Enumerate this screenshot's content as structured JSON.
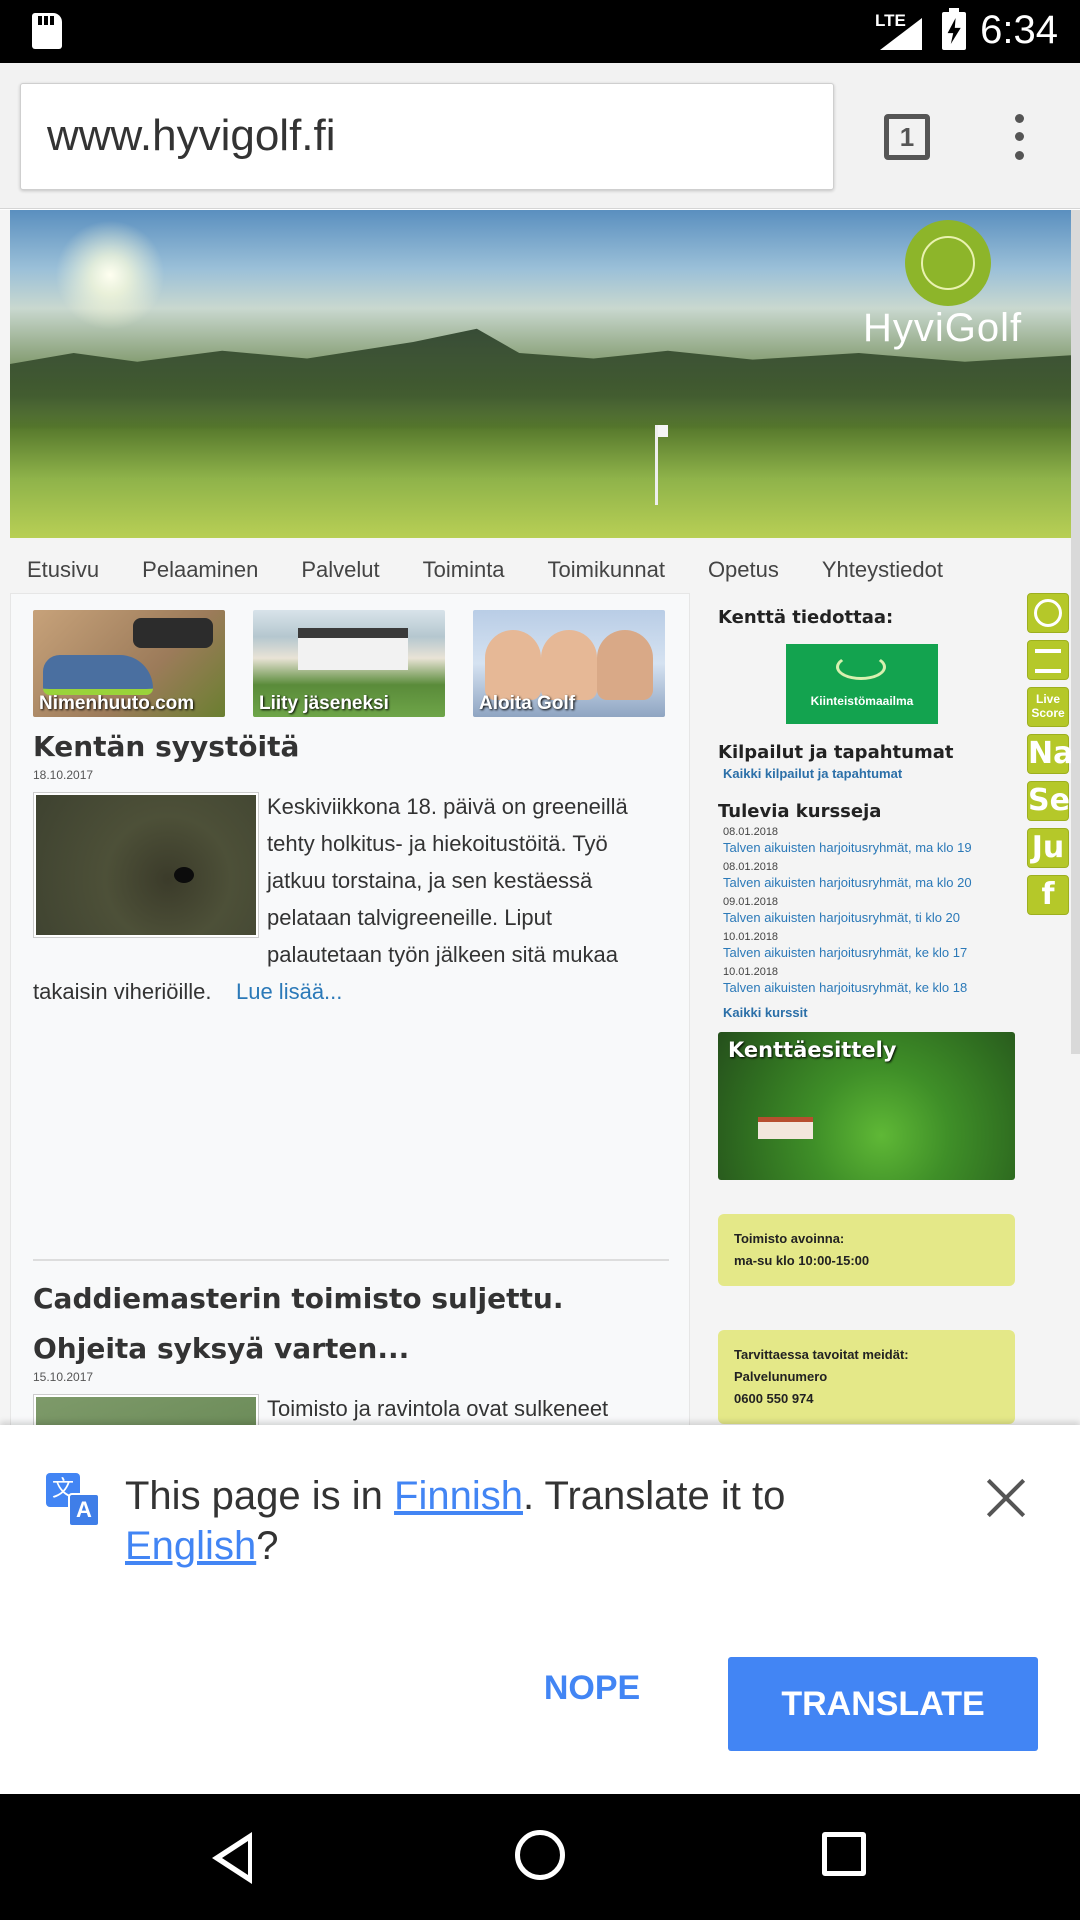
{
  "status_bar": {
    "network": "LTE",
    "time": "6:34"
  },
  "browser": {
    "url": "www.hyvigolf.fi",
    "tab_count": "1"
  },
  "site": {
    "logo_text": "HyviGolf",
    "nav": [
      "Etusivu",
      "Pelaaminen",
      "Palvelut",
      "Toiminta",
      "Toimikunnat",
      "Opetus",
      "Yhteystiedot"
    ],
    "promos": [
      "Nimenhuuto.com",
      "Liity jäseneksi",
      "Aloita Golf"
    ],
    "articles": [
      {
        "title": "Kentän syystöitä",
        "date": "18.10.2017",
        "body": "Keskiviikkona 18. päivä on greeneillä tehty holkitus- ja hiekoitustöitä. Työ jatkuu torstaina, ja sen kestäessä pelataan talvigreeneille. Liput palautetaan työn jälkeen sitä mukaa takaisin viheriöille.",
        "read_more": "Lue lisää..."
      },
      {
        "title": "Caddiemasterin toimisto suljettu. Ohjeita syksyä varten...",
        "date": "15.10.2017",
        "body": "Toimisto ja ravintola ovat sulkeneet ovensa tämän kauden osalta. Myös taukokioskin wc:t on suljettu. Talvikaudella tavoitatte meidät seuraavasti: Hyvigolf Oy:n asiat: mika.nieminen@hyvigolf.fi tai 040 5290706 Hyvinkään Golf ry:n seura-asiat: petteri.oksanen@hyvigolf.fi tai 0400 612174"
      }
    ],
    "sidebar": {
      "notice_heading": "Kenttä tiedottaa:",
      "notice_logo": "Kiinteistömaailma",
      "events_heading": "Kilpailut ja tapahtumat",
      "events_link": "Kaikki kilpailut ja tapahtumat",
      "courses_heading": "Tulevia kursseja",
      "courses": [
        {
          "date": "08.01.2018",
          "name": "Talven aikuisten harjoitusryhmät, ma klo 19"
        },
        {
          "date": "08.01.2018",
          "name": "Talven aikuisten harjoitusryhmät, ma klo 20"
        },
        {
          "date": "09.01.2018",
          "name": "Talven aikuisten harjoitusryhmät, ti klo 20"
        },
        {
          "date": "10.01.2018",
          "name": "Talven aikuisten harjoitusryhmät, ke klo 17"
        },
        {
          "date": "10.01.2018",
          "name": "Talven aikuisten harjoitusryhmät, ke klo 18"
        }
      ],
      "courses_link": "Kaikki kurssit",
      "map_title": "Kenttäesittely",
      "office_hours": [
        "Toimisto avoinna:",
        "ma-su klo 10:00-15:00"
      ],
      "contact": [
        "Tarvittaessa tavoitat meidät:",
        "Palvelunumero",
        "0600 550 974"
      ]
    },
    "quick_links": [
      "Live Score",
      "Na",
      "Se",
      "Ju",
      "f"
    ]
  },
  "translate_bar": {
    "msg_prefix": "This page is in ",
    "source_language": "Finnish",
    "msg_middle": ". Translate it to ",
    "target_language": "English",
    "msg_suffix": "?",
    "nope_label": "NOPE",
    "translate_label": "TRANSLATE",
    "accent_color": "#4285f4"
  }
}
